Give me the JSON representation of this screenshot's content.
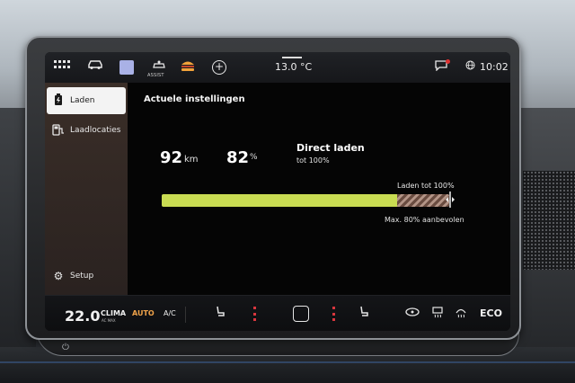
{
  "status_bar": {
    "icons": [
      "grid-icon",
      "car-icon",
      "apps-icon",
      "assist-icon",
      "burger-icon",
      "plus-icon",
      "message-icon",
      "globe-icon"
    ],
    "assist_label": "ASSIST",
    "temperature": "13.0 °C",
    "time": "10:02",
    "notification_color": "#e03131"
  },
  "sidebar": {
    "items": [
      {
        "label": "Laden",
        "icon": "battery-plug-icon",
        "active": true
      },
      {
        "label": "Laadlocaties",
        "icon": "charging-station-icon",
        "active": false
      },
      {
        "label": "Setup",
        "icon": "gear-icon",
        "active": false
      }
    ]
  },
  "main": {
    "title": "Actuele instellingen",
    "range_value": "92",
    "range_unit": "km",
    "soc_value": "82",
    "soc_unit": "%",
    "mode_title": "Direct laden",
    "mode_subtitle": "tot 100%",
    "limit_label": "Laden tot 100%",
    "recommendation": "Max. 80% aanbevolen",
    "charge_level_percent": 82,
    "recommended_max_percent": 80,
    "target_percent": 100,
    "fill_color": "#c9dc52"
  },
  "climate": {
    "temperature": "22.0",
    "clima_label": "CLIMA",
    "clima_sub": "AC MAX",
    "auto_label": "AUTO",
    "ac_label": "A/C",
    "eco_label": "ECO",
    "auto_color": "#f0a34a"
  }
}
